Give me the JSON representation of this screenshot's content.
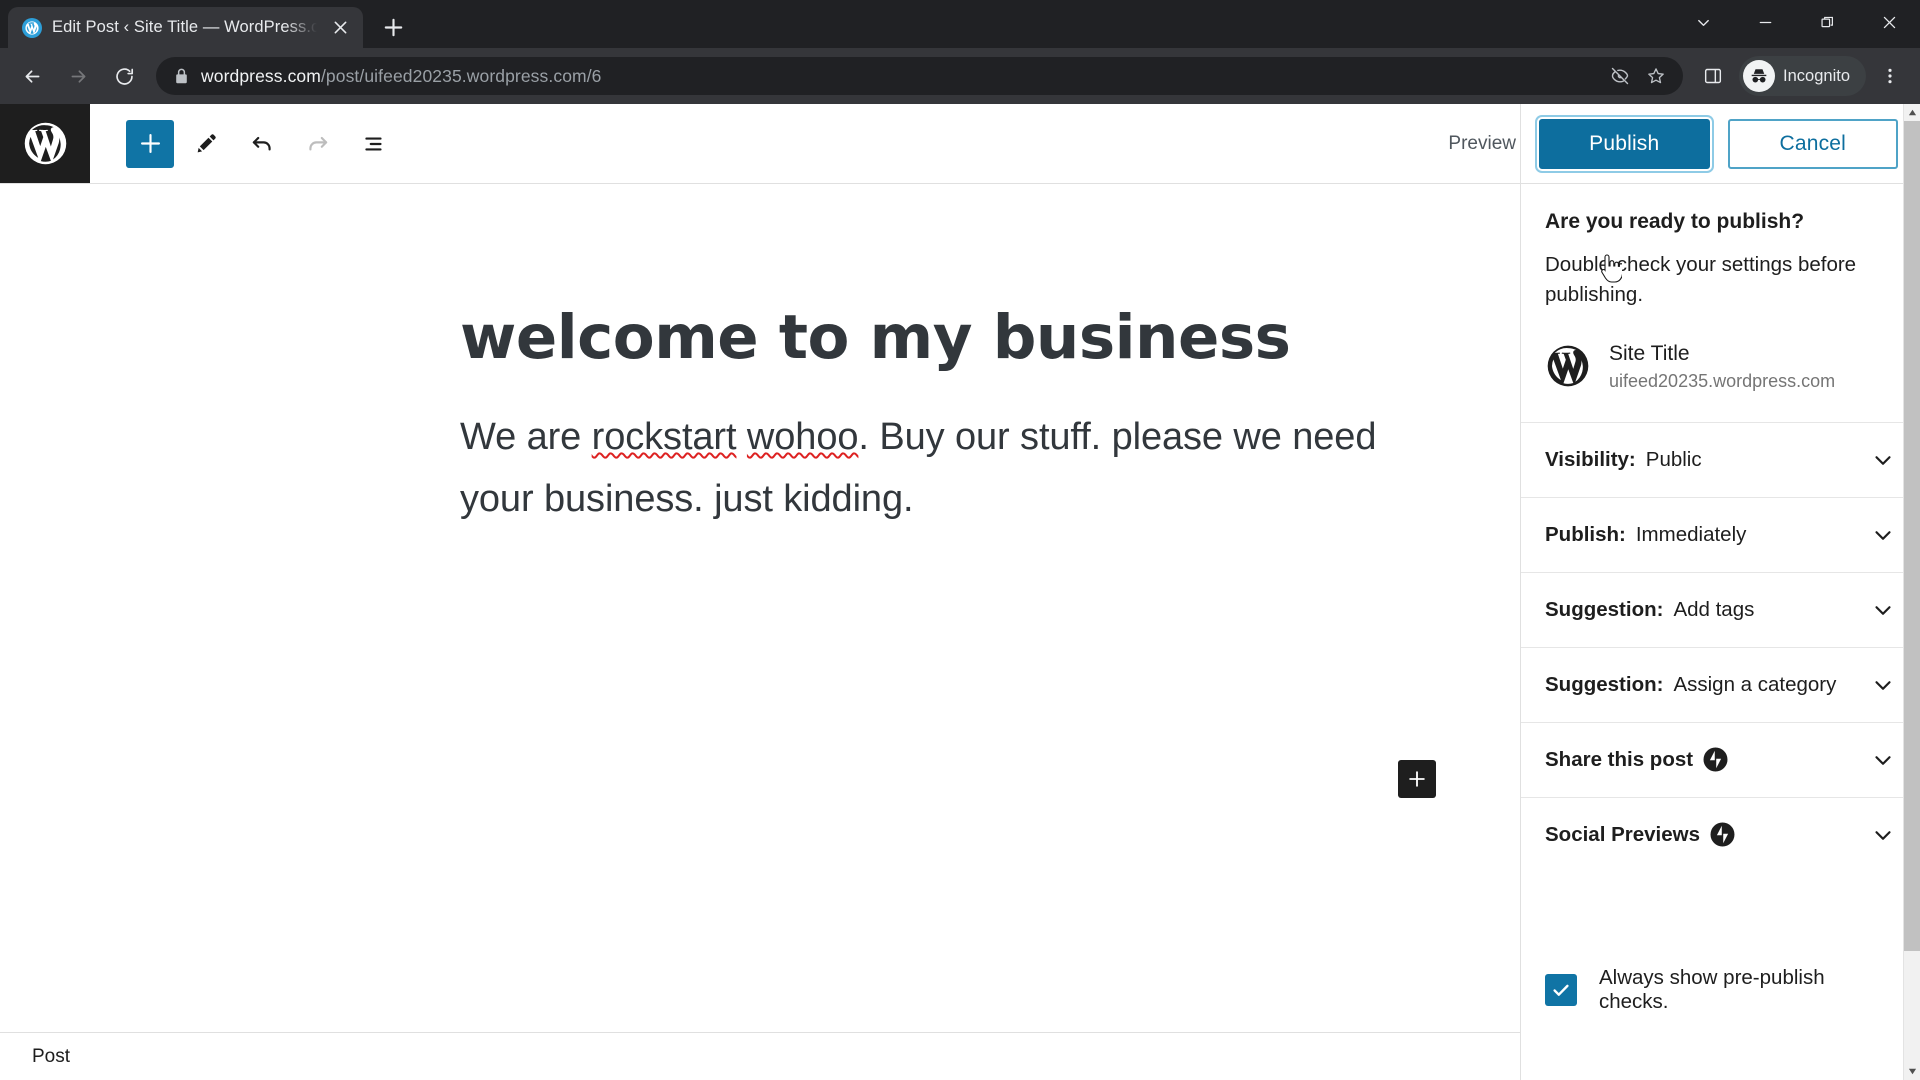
{
  "browser": {
    "tab": {
      "title": "Edit Post ‹ Site Title — WordPress.com",
      "favicon": "wordpress-favicon",
      "close": "close-tab-icon"
    },
    "new_tab_label": "New tab",
    "window_controls": {
      "tab_search": "Search tabs",
      "minimize": "Minimize",
      "restore": "Restore",
      "close": "Close"
    },
    "nav": {
      "back": "Back",
      "forward": "Forward",
      "reload": "Reload"
    },
    "omnibox": {
      "host": "wordpress.com",
      "path": "/post/uifeed20235.wordpress.com/6",
      "full_url": "wordpress.com/post/uifeed20235.wordpress.com/6",
      "lock": "site-information-lock-icon"
    },
    "omni_actions": {
      "tracking_protection": "eye-off-icon",
      "bookmark": "star-icon"
    },
    "toolbar_actions": {
      "side_panel": "side-panel-icon",
      "profile_label": "Incognito",
      "menu": "three-dot-menu-icon"
    }
  },
  "editor": {
    "logo": "wordpress-logo-icon",
    "tools": [
      {
        "name": "add-block",
        "icon": "plus-icon",
        "label": "Add block",
        "state": "primary"
      },
      {
        "name": "edit-tool",
        "icon": "pencil-icon",
        "label": "Tools",
        "state": "normal"
      },
      {
        "name": "undo",
        "icon": "undo-arrow-icon",
        "label": "Undo",
        "state": "normal"
      },
      {
        "name": "redo",
        "icon": "redo-arrow-icon",
        "label": "Redo",
        "state": "disabled"
      },
      {
        "name": "list-view",
        "icon": "list-view-icon",
        "label": "Document overview",
        "state": "normal"
      }
    ],
    "preview_label": "Preview",
    "post": {
      "title": "welcome to my business",
      "paragraph_parts": [
        {
          "text": "We are ",
          "spellcheck": false
        },
        {
          "text": "rockstart",
          "spellcheck": true
        },
        {
          "text": " ",
          "spellcheck": false
        },
        {
          "text": "wohoo",
          "spellcheck": true
        },
        {
          "text": ". Buy our stuff. please we need your business. just kidding.",
          "spellcheck": false
        }
      ]
    },
    "inserter_icon": "plus-icon",
    "breadcrumb": "Post"
  },
  "sidebar": {
    "publish_button": "Publish",
    "cancel_button": "Cancel",
    "heading": "Are you ready to publish?",
    "subtext": "Double-check your settings before publishing.",
    "site": {
      "logo": "wordpress-logo-icon",
      "name": "Site Title",
      "url": "uifeed20235.wordpress.com"
    },
    "rows": [
      {
        "name": "visibility",
        "label": "Visibility:",
        "value": "Public",
        "jetpack": false
      },
      {
        "name": "publish-schedule",
        "label": "Publish:",
        "value": "Immediately",
        "jetpack": false
      },
      {
        "name": "suggestion-tags",
        "label": "Suggestion:",
        "value": "Add tags",
        "jetpack": false
      },
      {
        "name": "suggestion-category",
        "label": "Suggestion:",
        "value": "Assign a category",
        "jetpack": false
      },
      {
        "name": "share-this-post",
        "label": "Share this post",
        "value": "",
        "jetpack": true
      },
      {
        "name": "social-previews",
        "label": "Social Previews",
        "value": "",
        "jetpack": true
      }
    ],
    "checkbox": {
      "checked": true,
      "label": "Always show pre-publish checks."
    }
  },
  "colors": {
    "accent_blue": "#0d6e9e",
    "toolbar_blue": "#1074a5",
    "chrome_dark": "#202124",
    "chrome_toolbar": "#35363a",
    "text_dark": "#1e1e1e",
    "heading_navy": "#32373c",
    "spellcheck_red": "#dd2222"
  }
}
